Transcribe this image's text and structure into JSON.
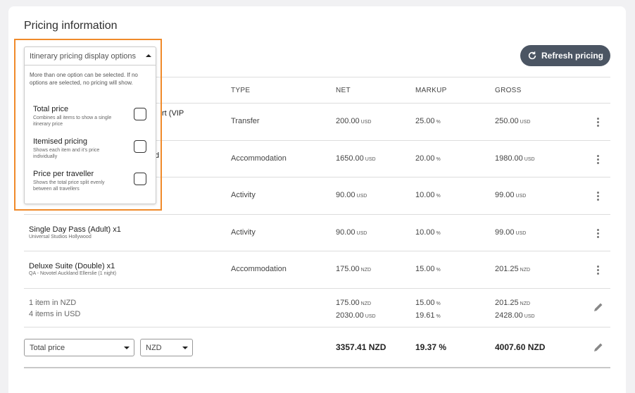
{
  "title": "Pricing information",
  "refresh_label": "Refresh pricing",
  "columns": {
    "type": "TYPE",
    "net": "NET",
    "markup": "MARKUP",
    "gross": "GROSS"
  },
  "rows": [
    {
      "name": "rt (VIP",
      "sub": "",
      "type": "Transfer",
      "net": "200.00",
      "net_unit": "USD",
      "markup": "25.00",
      "markup_unit": "%",
      "gross": "250.00",
      "gross_unit": "USD"
    },
    {
      "name": "d",
      "sub": "",
      "type": "Accommodation",
      "net": "1650.00",
      "net_unit": "USD",
      "markup": "20.00",
      "markup_unit": "%",
      "gross": "1980.00",
      "gross_unit": "USD"
    },
    {
      "name": "",
      "sub": "",
      "type": "Activity",
      "net": "90.00",
      "net_unit": "USD",
      "markup": "10.00",
      "markup_unit": "%",
      "gross": "99.00",
      "gross_unit": "USD"
    },
    {
      "name": "Single Day Pass (Adult) x1",
      "sub": "Universal Studios Hollywood",
      "type": "Activity",
      "net": "90.00",
      "net_unit": "USD",
      "markup": "10.00",
      "markup_unit": "%",
      "gross": "99.00",
      "gross_unit": "USD"
    },
    {
      "name": "Deluxe Suite (Double) x1",
      "sub": "QA - Novotel Auckland Ellerslie (1 night)",
      "type": "Accommodation",
      "net": "175.00",
      "net_unit": "NZD",
      "markup": "15.00",
      "markup_unit": "%",
      "gross": "201.25",
      "gross_unit": "NZD"
    }
  ],
  "summary": {
    "line1": "1 item in NZD",
    "line2": "4 items in USD",
    "net1": "175.00",
    "net1_unit": "NZD",
    "net2": "2030.00",
    "net2_unit": "USD",
    "markup1": "15.00",
    "markup1_unit": "%",
    "markup2": "19.61",
    "markup2_unit": "%",
    "gross1": "201.25",
    "gross1_unit": "NZD",
    "gross2": "2428.00",
    "gross2_unit": "USD"
  },
  "totals": {
    "display_select": "Total price",
    "currency_select": "NZD",
    "net": "3357.41 NZD",
    "markup": "19.37 %",
    "gross": "4007.60 NZD"
  },
  "popover": {
    "header": "Itinerary pricing display options",
    "note": "More than one option can be selected. If no options are selected, no pricing will show.",
    "options": [
      {
        "title": "Total price",
        "desc": "Combines all items to show a single itinerary price"
      },
      {
        "title": "Itemised pricing",
        "desc": "Shows each item and it's price individually"
      },
      {
        "title": "Price per traveller",
        "desc": "Shows the total price split evenly between all travellers"
      }
    ]
  },
  "colors": {
    "accent_highlight": "#f08a2a",
    "button_bg": "#4b5563"
  }
}
